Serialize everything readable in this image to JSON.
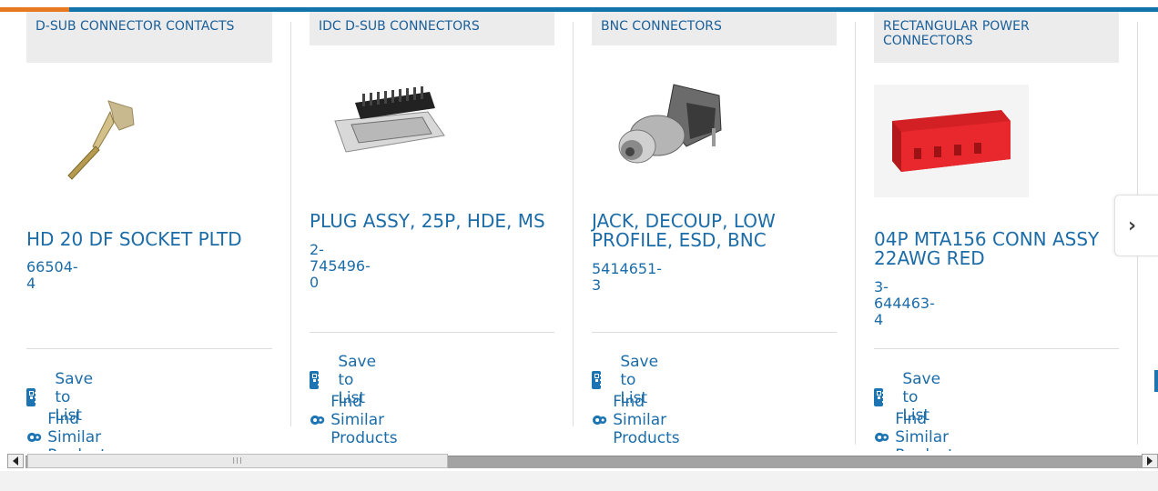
{
  "carousel": {
    "next_icon": "chevron-right-icon",
    "cards": [
      {
        "category": "D-SUB CONNECTOR CONTACTS",
        "title": "HD 20 DF SOCKET PLTD",
        "part_number": "66504-4",
        "image": "crimp-socket-contact",
        "save_label": "Save to List",
        "similar_label": "Find Similar Products"
      },
      {
        "category": "IDC D-SUB CONNECTORS",
        "title": "PLUG ASSY, 25P, HDE, MS",
        "part_number": "2-745496-0",
        "image": "dsub-plug-idc",
        "save_label": "Save to List",
        "similar_label": "Find Similar Products"
      },
      {
        "category": "BNC CONNECTORS",
        "title": "JACK, DECOUP, LOW PROFILE, ESD, BNC",
        "part_number": "5414651-3",
        "image": "bnc-jack",
        "save_label": "Save to List",
        "similar_label": "Find Similar Products"
      },
      {
        "category": "RECTANGULAR POWER CONNECTORS",
        "title": "04P MTA156 CONN ASSY 22AWG RED",
        "part_number": "3-644463-4",
        "image": "red-mta156-housing",
        "save_label": "Save to List",
        "similar_label": "Find Similar Products"
      }
    ]
  },
  "colors": {
    "brand_blue": "#1374ab",
    "accent_orange": "#e77a20",
    "link_blue": "#1c6ca8",
    "category_bg": "#ececec"
  },
  "icons": {
    "save": "list-check-icon",
    "similar": "gears-icon"
  },
  "scrollbar": {
    "grip": "III"
  }
}
